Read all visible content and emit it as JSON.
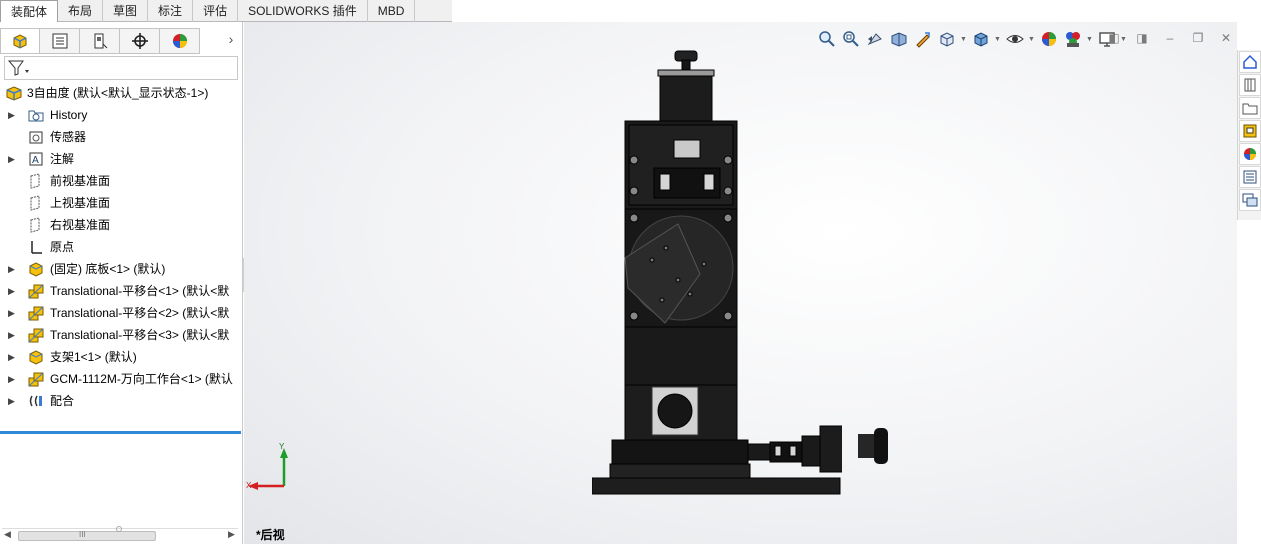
{
  "ribbon": {
    "tabs": [
      "装配体",
      "布局",
      "草图",
      "标注",
      "评估",
      "SOLIDWORKS 插件",
      "MBD"
    ],
    "active": "装配体"
  },
  "feature_tree": {
    "root": "3自由度 (默认<默认_显示状态-1>)",
    "items": [
      {
        "label": "History",
        "icon": "history-folder-icon",
        "expandable": true
      },
      {
        "label": "传感器",
        "icon": "sensor-icon",
        "expandable": false
      },
      {
        "label": "注解",
        "icon": "annotation-icon",
        "expandable": true
      },
      {
        "label": "前视基准面",
        "icon": "plane-icon",
        "expandable": false
      },
      {
        "label": "上视基准面",
        "icon": "plane-icon",
        "expandable": false
      },
      {
        "label": "右视基准面",
        "icon": "plane-icon",
        "expandable": false
      },
      {
        "label": "原点",
        "icon": "origin-icon",
        "expandable": false
      },
      {
        "label": "(固定) 底板<1> (默认)",
        "icon": "part-icon",
        "expandable": true
      },
      {
        "label": "Translational-平移台<1> (默认<默",
        "icon": "subassembly-icon",
        "expandable": true
      },
      {
        "label": "Translational-平移台<2> (默认<默",
        "icon": "subassembly-icon",
        "expandable": true
      },
      {
        "label": "Translational-平移台<3> (默认<默",
        "icon": "subassembly-icon",
        "expandable": true
      },
      {
        "label": "支架1<1> (默认)",
        "icon": "part-icon",
        "expandable": true
      },
      {
        "label": "GCM-1112M-万向工作台<1> (默认",
        "icon": "subassembly-icon",
        "expandable": true
      },
      {
        "label": "配合",
        "icon": "mates-icon",
        "expandable": true
      }
    ],
    "scrollbar_grip": "III"
  },
  "viewport": {
    "view_name": "*后视",
    "triad": {
      "y": "Y",
      "x": "X"
    }
  },
  "colors": {
    "accent": "#2e8ad8",
    "model": "#1a1a1a",
    "triad_y": "#1f9d2a",
    "triad_x": "#d42020"
  }
}
